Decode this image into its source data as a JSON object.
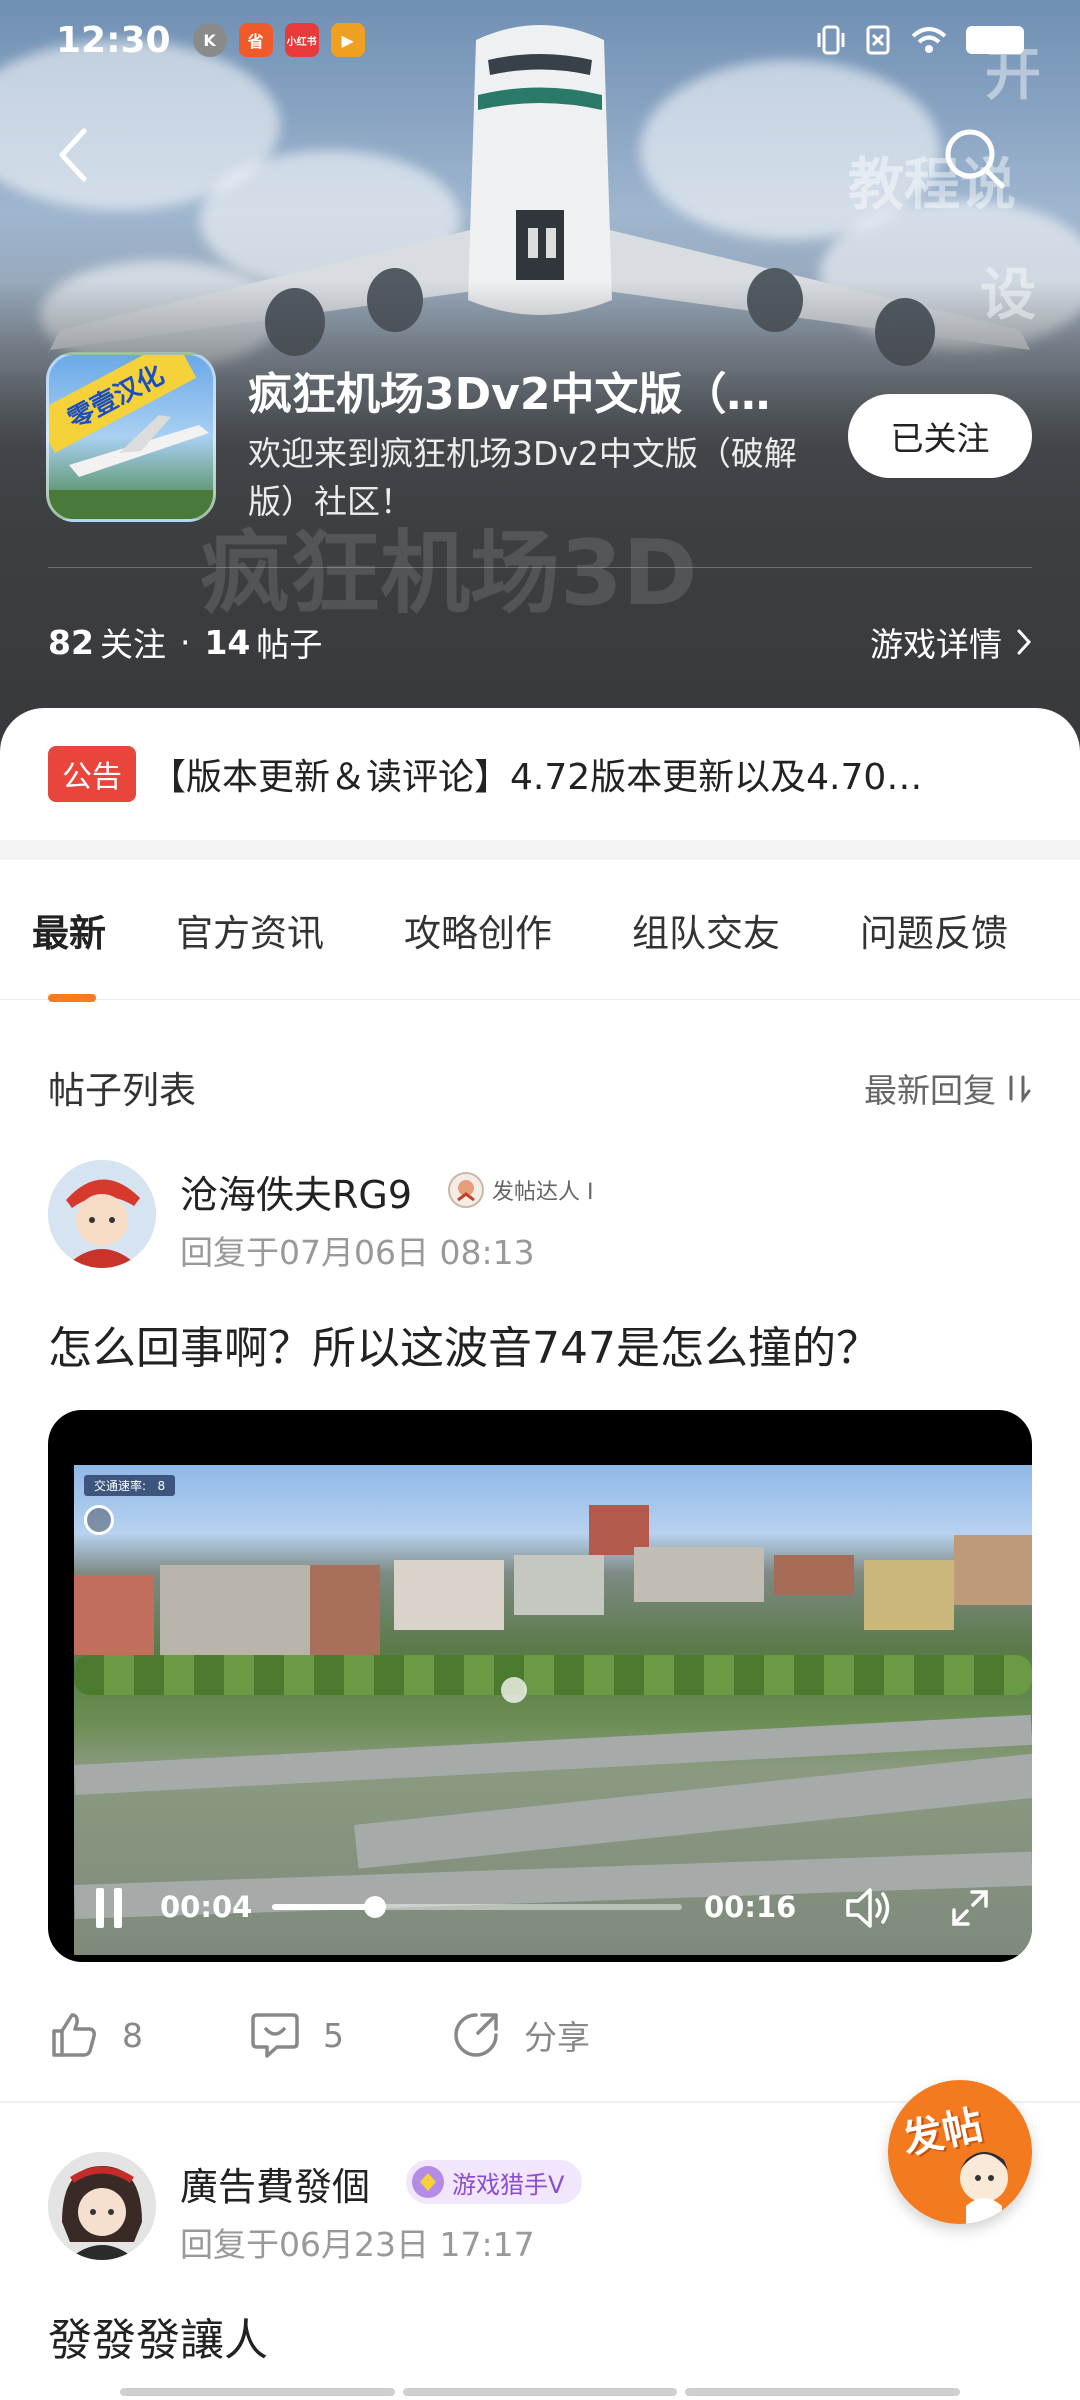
{
  "status_bar": {
    "time": "12:30",
    "apps": [
      {
        "icon": "k-app-icon",
        "label": "K",
        "color": "#7a7a7a"
      },
      {
        "icon": "shop-app-icon",
        "label": "省",
        "color": "#f05a2a"
      },
      {
        "icon": "xiaohongshu-app-icon",
        "label": "小红书",
        "color": "#e83a3a"
      },
      {
        "icon": "video-app-icon",
        "label": "▶",
        "color": "#f0a020"
      }
    ]
  },
  "community": {
    "icon_tag": "零壹汉化",
    "title": "疯狂机场3Dv2中文版（…",
    "description": "欢迎来到疯狂机场3Dv2中文版（破解版）社区！",
    "follow_label": "已关注",
    "followers_count": "82",
    "followers_label": "关注",
    "posts_count": "14",
    "posts_label": "帖子",
    "game_detail_label": "游戏详情"
  },
  "notice": {
    "badge": "公告",
    "text": "【版本更新＆读评论】4.72版本更新以及4.70…"
  },
  "tabs": [
    {
      "label": "最新",
      "active": true
    },
    {
      "label": "官方资讯",
      "active": false
    },
    {
      "label": "攻略创作",
      "active": false
    },
    {
      "label": "组队交友",
      "active": false
    },
    {
      "label": "问题反馈",
      "active": false
    }
  ],
  "list": {
    "title": "帖子列表",
    "sort_label": "最新回复"
  },
  "posts": [
    {
      "author": "沧海佚夫RG9",
      "badge": "发帖达人 I",
      "time": "回复于07月06日 08:13",
      "title": "怎么回事啊？所以这波音747是怎么撞的？",
      "video": {
        "traffic_label": "交通速率:",
        "traffic_value": "8",
        "current_time": "00:04",
        "duration": "00:16",
        "progress": 0.25
      },
      "likes": "8",
      "comments": "5",
      "share_label": "分享"
    },
    {
      "author": "廣告費發個",
      "badge": "游戏猎手V",
      "time": "回复于06月23日 17:17",
      "title": "發發發讓人"
    }
  ],
  "fab": {
    "label": "发帖"
  },
  "colors": {
    "accent": "#ff7a1a",
    "notice_badge": "#e8453c",
    "fab": "#f47a1f"
  }
}
